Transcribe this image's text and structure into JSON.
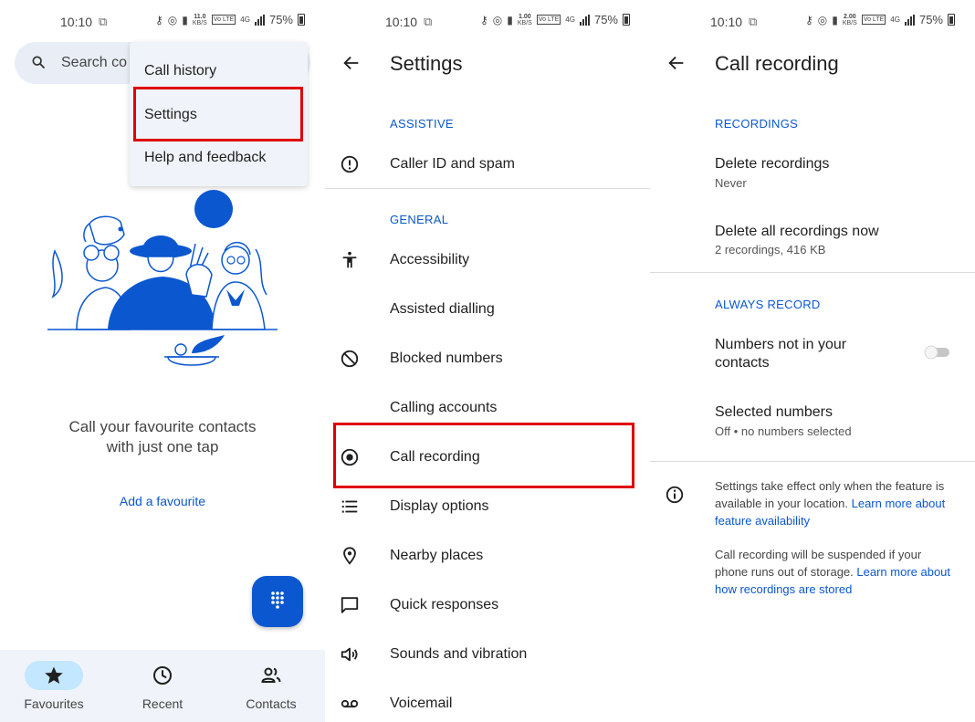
{
  "status": [
    {
      "time": "10:10",
      "speed_value": "11.0",
      "speed_unit": "KB/S",
      "volte": "Vo LTE",
      "network": "4G",
      "battery": "75%"
    },
    {
      "time": "10:10",
      "speed_value": "1.00",
      "speed_unit": "KB/S",
      "volte": "Vo LTE",
      "network": "4G",
      "battery": "75%"
    },
    {
      "time": "10:10",
      "speed_value": "2.00",
      "speed_unit": "KB/S",
      "volte": "Vo LTE",
      "network": "4G",
      "battery": "75%"
    }
  ],
  "phone": {
    "search_placeholder": "Search co",
    "menu": [
      "Call history",
      "Settings",
      "Help and feedback"
    ],
    "empty_message": "Call your favourite contacts with just one tap",
    "add_favourite": "Add a favourite",
    "nav": [
      {
        "label": "Favourites",
        "icon": "star-icon",
        "active": true
      },
      {
        "label": "Recent",
        "icon": "clock-icon",
        "active": false
      },
      {
        "label": "Contacts",
        "icon": "contacts-icon",
        "active": false
      }
    ]
  },
  "settings": {
    "title": "Settings",
    "sections": [
      {
        "header": "ASSISTIVE",
        "items": [
          {
            "label": "Caller ID and spam",
            "icon": "alert-icon"
          }
        ]
      },
      {
        "header": "GENERAL",
        "items": [
          {
            "label": "Accessibility",
            "icon": "accessibility-icon"
          },
          {
            "label": "Assisted dialling",
            "icon": ""
          },
          {
            "label": "Blocked numbers",
            "icon": "block-icon"
          },
          {
            "label": "Calling accounts",
            "icon": ""
          },
          {
            "label": "Call recording",
            "icon": "record-icon"
          },
          {
            "label": "Display options",
            "icon": "list-icon"
          },
          {
            "label": "Nearby places",
            "icon": "location-icon"
          },
          {
            "label": "Quick responses",
            "icon": "message-icon"
          },
          {
            "label": "Sounds and vibration",
            "icon": "volume-icon"
          },
          {
            "label": "Voicemail",
            "icon": "voicemail-icon"
          }
        ]
      }
    ]
  },
  "recording": {
    "title": "Call recording",
    "section1": "RECORDINGS",
    "delete_recordings": {
      "label": "Delete recordings",
      "value": "Never"
    },
    "delete_all": {
      "label": "Delete all recordings now",
      "value": "2 recordings, 416 KB"
    },
    "section2": "ALWAYS RECORD",
    "not_in_contacts": {
      "label_line1": "Numbers not in your",
      "label_line2": "contacts",
      "enabled": false
    },
    "selected_numbers": {
      "label": "Selected numbers",
      "value": "Off • no numbers selected"
    },
    "note1": {
      "text": "Settings take effect only when the feature is available in your location.",
      "link": "Learn more about feature availability"
    },
    "note2": {
      "text": "Call recording will be suspended if your phone runs out of storage.",
      "link": "Learn more about how recordings are stored"
    }
  },
  "colors": {
    "accent": "#0b57d0",
    "highlight": "#e00000",
    "nav_background": "#f0f4fa",
    "active_pill": "#c2e7ff"
  }
}
